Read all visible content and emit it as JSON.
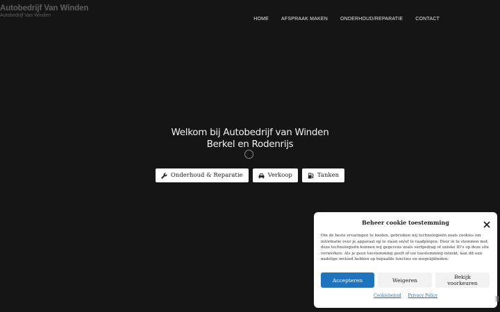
{
  "brand": {
    "title": "Autobedrijf Van Winden",
    "subtitle": "Autobedrijf Van Winden"
  },
  "nav": [
    {
      "label": "HOME"
    },
    {
      "label": "AFSPRAAK MAKEN"
    },
    {
      "label": "ONDERHOUD/REPARATIE"
    },
    {
      "label": "CONTACT"
    }
  ],
  "hero": {
    "line1": "Welkom bij Autobedrijf van Winden",
    "line2": "Berkel en Rodenrijs"
  },
  "buttons": [
    {
      "label": "Onderhoud & Reparatie",
      "icon": "wrench-icon"
    },
    {
      "label": "Verkoop",
      "icon": "car-icon"
    },
    {
      "label": "Tanken",
      "icon": "gas-pump-icon"
    }
  ],
  "cookie": {
    "title": "Beheer cookie toestemming",
    "text": "Om de beste ervaringen te bieden, gebruiken wij technologieën zoals cookies om informatie over je apparaat op te slaan en/of te raadplegen. Door in te stemmen met deze technologieën kunnen wij gegevens zoals surfgedrag of unieke ID's op deze site verwerken. Als je geen toestemming geeft of uw toestemming intrekt, kan dit een nadelige invloed hebben op bepaalde functies en mogelijkheden.",
    "accept": "Accepteren",
    "deny": "Weigeren",
    "prefs": "Bekijk voorkeuren",
    "link1": "Cookiebeleid",
    "link2": "Privacy Policy",
    "accent": "#1e73be"
  }
}
